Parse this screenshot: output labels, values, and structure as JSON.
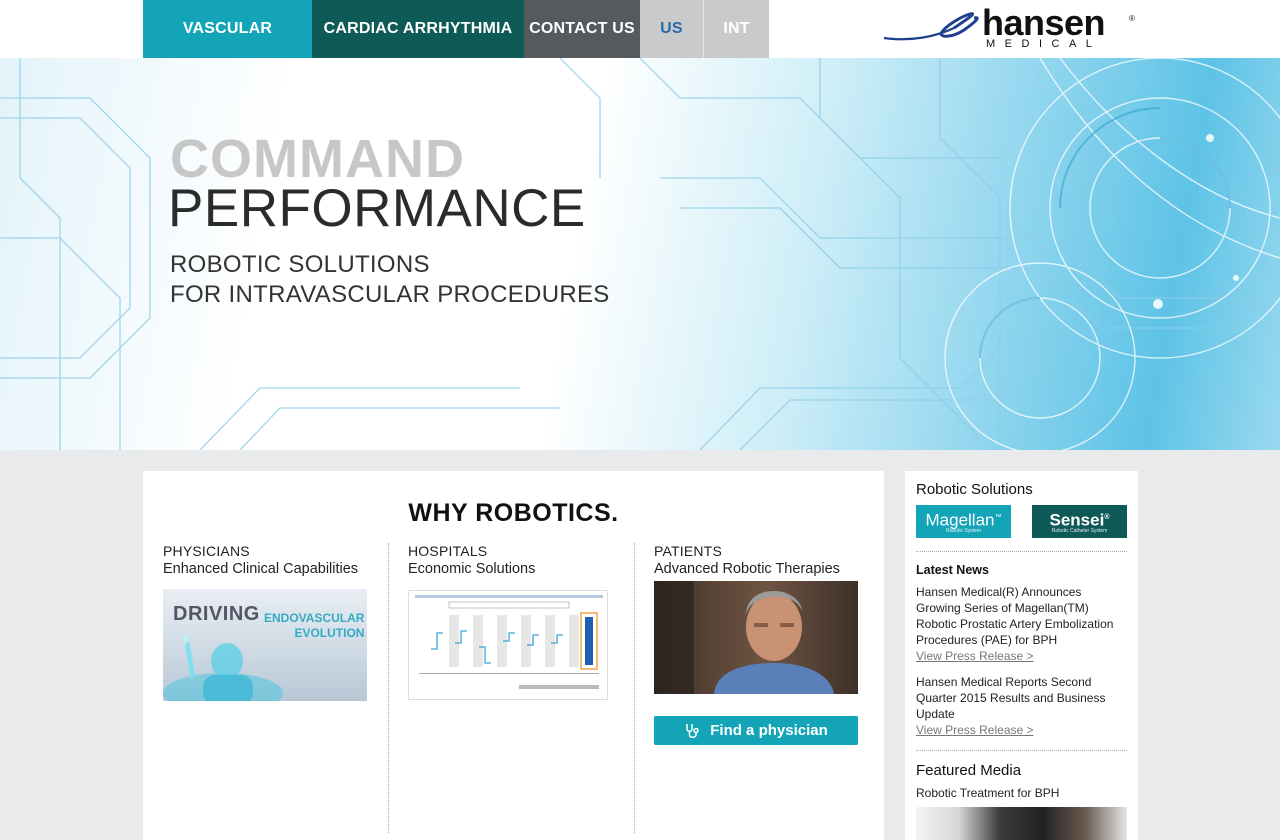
{
  "nav": {
    "items": [
      "VASCULAR",
      "CARDIAC ARRHYTHMIA",
      "CONTACT US",
      "US",
      "INT"
    ]
  },
  "logo": {
    "word": "hansen",
    "reg": "®",
    "sub": "MEDICAL"
  },
  "hero": {
    "line1": "COMMAND",
    "line2": "PERFORMANCE",
    "tagline1": "ROBOTIC SOLUTIONS",
    "tagline2": "FOR INTRAVASCULAR PROCEDURES"
  },
  "main": {
    "title": "WHY ROBOTICS.",
    "columns": [
      {
        "head": "PHYSICIANS",
        "sub": "Enhanced Clinical Capabilities"
      },
      {
        "head": "HOSPITALS",
        "sub": "Economic Solutions"
      },
      {
        "head": "PATIENTS",
        "sub": "Advanced Robotic Therapies"
      }
    ],
    "driving": {
      "big": "DRIVING",
      "small1": "ENDOVASCULAR",
      "small2": "EVOLUTION"
    },
    "find_button": "Find a physician"
  },
  "sidebar": {
    "robotic_solutions": "Robotic Solutions",
    "magellan": {
      "name": "Magellan",
      "tm": "™",
      "sub": "Robotic System"
    },
    "sensei": {
      "name": "Sensei",
      "tm": "®",
      "sub": "Robotic Catheter System"
    },
    "latest_news": "Latest News",
    "news": [
      {
        "text": "Hansen Medical(R) Announces Growing Series of Magellan(TM) Robotic Prostatic Artery Embolization Procedures (PAE) for BPH",
        "link": "View Press Release >"
      },
      {
        "text": "Hansen Medical Reports Second Quarter 2015 Results and Business Update",
        "link": "View Press Release >"
      }
    ],
    "featured_media": "Featured Media",
    "featured_title": "Robotic Treatment for BPH"
  },
  "colors": {
    "teal": "#13a4b8",
    "dark_teal": "#0e5a57",
    "gray_nav": "#555a5f",
    "light_nav": "#c9cacb",
    "us_blue": "#2c6aa8"
  }
}
